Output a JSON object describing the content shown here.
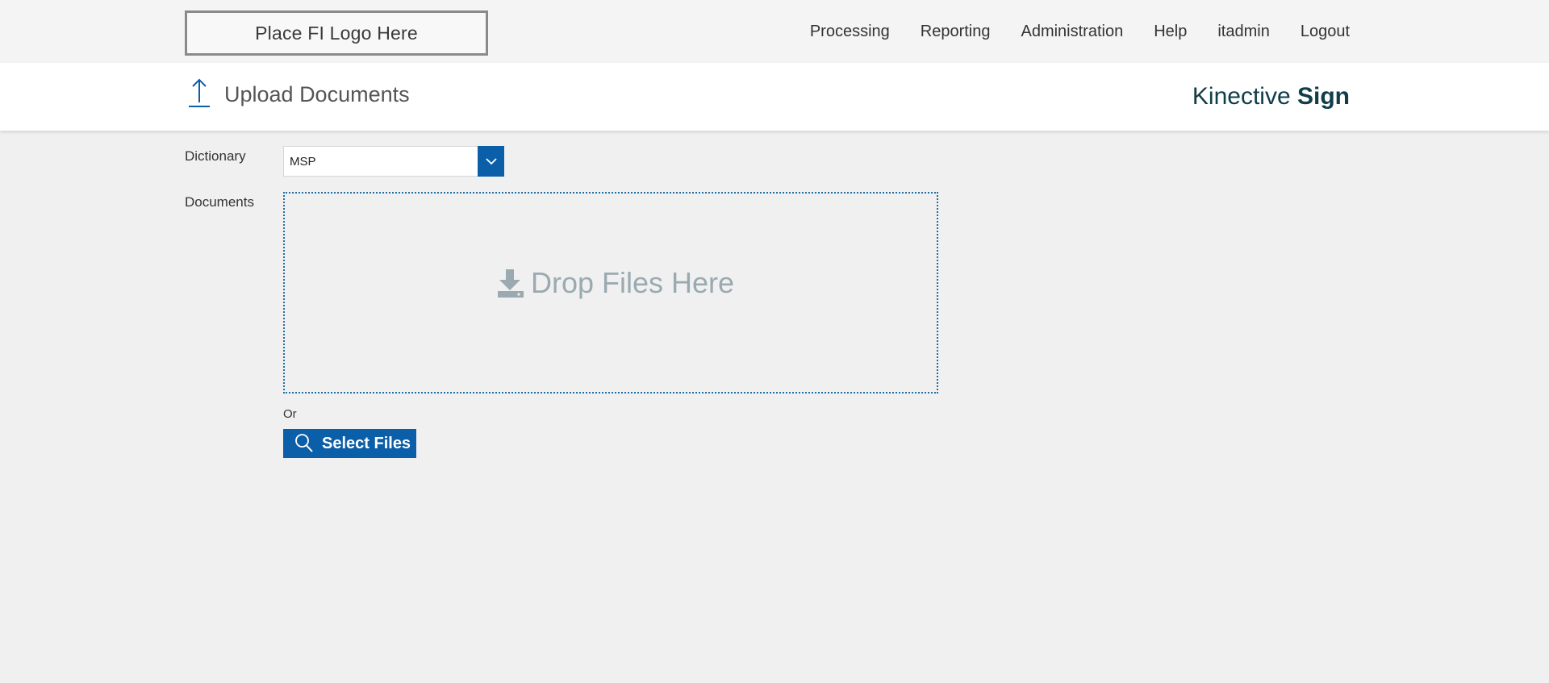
{
  "header": {
    "logo_text": "Place FI Logo Here",
    "nav": [
      {
        "label": "Processing"
      },
      {
        "label": "Reporting"
      },
      {
        "label": "Administration"
      },
      {
        "label": "Help"
      },
      {
        "label": "itadmin"
      },
      {
        "label": "Logout"
      }
    ]
  },
  "titlebar": {
    "icon": "upload-arrow-icon",
    "title": "Upload Documents",
    "brand_light": "Kinective ",
    "brand_bold": "Sign"
  },
  "form": {
    "dictionary_label": "Dictionary",
    "dictionary_value": "MSP",
    "documents_label": "Documents",
    "dropzone_text": "Drop Files Here",
    "dropzone_icon": "download-icon",
    "or_text": "Or",
    "select_files_label": "Select Files",
    "select_files_icon": "search-icon"
  },
  "colors": {
    "accent": "#0b5ea8",
    "brand": "#0f3d4a",
    "dropzone_text": "#9aaab0",
    "dropzone_border": "#1e6ea0"
  }
}
